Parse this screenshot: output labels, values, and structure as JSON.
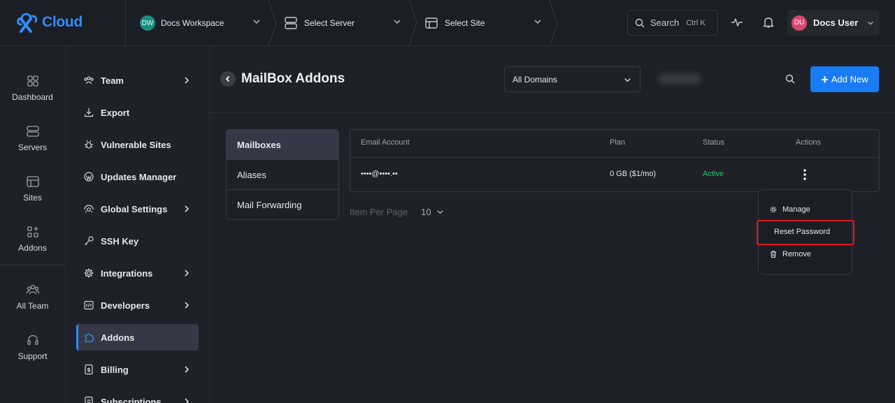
{
  "brand": {
    "name": "Cloud"
  },
  "topbar": {
    "workspace": {
      "initials": "DW",
      "label": "Docs Workspace"
    },
    "server": {
      "label": "Select Server"
    },
    "site": {
      "label": "Select Site"
    },
    "search": {
      "label": "Search",
      "shortcut": "Ctrl K"
    },
    "user": {
      "initials": "DU",
      "name": "Docs User"
    }
  },
  "rail": {
    "items": [
      {
        "label": "Dashboard",
        "icon": "dashboard-icon"
      },
      {
        "label": "Servers",
        "icon": "servers-icon"
      },
      {
        "label": "Sites",
        "icon": "sites-icon"
      },
      {
        "label": "Addons",
        "icon": "addons-icon"
      },
      {
        "label": "All Team",
        "icon": "team-icon"
      },
      {
        "label": "Support",
        "icon": "headset-icon"
      }
    ]
  },
  "sidebar": {
    "items": [
      {
        "label": "Team",
        "icon": "team-icon",
        "expandable": true
      },
      {
        "label": "Export",
        "icon": "export-icon",
        "expandable": false
      },
      {
        "label": "Vulnerable Sites",
        "icon": "bug-icon",
        "expandable": false
      },
      {
        "label": "Updates Manager",
        "icon": "wordpress-icon",
        "expandable": false
      },
      {
        "label": "Global Settings",
        "icon": "global-settings-icon",
        "expandable": true
      },
      {
        "label": "SSH Key",
        "icon": "key-icon",
        "expandable": false
      },
      {
        "label": "Integrations",
        "icon": "gear-icon",
        "expandable": true
      },
      {
        "label": "Developers",
        "icon": "code-icon",
        "expandable": true
      },
      {
        "label": "Addons",
        "icon": "puzzle-icon",
        "expandable": false,
        "active": true
      },
      {
        "label": "Billing",
        "icon": "billing-icon",
        "expandable": true
      },
      {
        "label": "Subscriptions",
        "icon": "subscriptions-icon",
        "expandable": true
      }
    ]
  },
  "main": {
    "title": "MailBox Addons",
    "domain_filter": "All Domains",
    "search_placeholder": "",
    "add_button": "Add New",
    "tabs": [
      {
        "label": "Mailboxes",
        "active": true
      },
      {
        "label": "Aliases",
        "active": false
      },
      {
        "label": "Mail Forwarding",
        "active": false
      }
    ],
    "table": {
      "columns": [
        "Email Account",
        "Plan",
        "Status",
        "Actions"
      ],
      "rows": [
        {
          "email": "••••@••••.••",
          "plan": "0 GB ($1/mo)",
          "status": "Active"
        }
      ]
    },
    "pagination": {
      "label": "Item Per Page",
      "value": "10"
    },
    "action_menu": {
      "items": [
        {
          "label": "Manage",
          "icon": "gear-icon"
        },
        {
          "label": "Reset Password",
          "icon": "",
          "highlighted": true
        },
        {
          "label": "Remove",
          "icon": "trash-icon"
        }
      ]
    }
  },
  "colors": {
    "accent": "#1a7cf5",
    "status_active": "#2dbf6b",
    "highlight_border": "#e0161e",
    "background": "#1f2129"
  }
}
